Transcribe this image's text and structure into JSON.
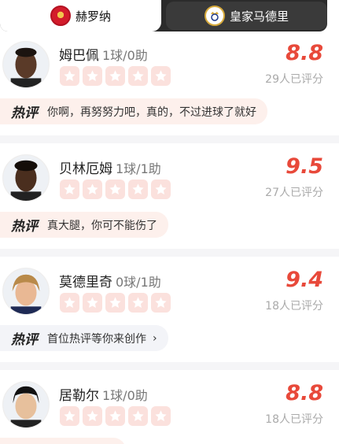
{
  "tabs": [
    {
      "label": "赫罗纳",
      "icon": "girona-crest-icon",
      "active": true
    },
    {
      "label": "皇家马德里",
      "icon": "real-madrid-crest-icon",
      "active": false
    }
  ],
  "players": [
    {
      "name": "姆巴佩",
      "stats": "1球/0助",
      "score": "8.8",
      "rated_count": "29人已评分",
      "stars_filled": 0,
      "hot_label": "热评",
      "hot_text": "你啊，再努努力吧，真的，不过进球了就好"
    },
    {
      "name": "贝林厄姆",
      "stats": "1球/1助",
      "score": "9.5",
      "rated_count": "27人已评分",
      "stars_filled": 0,
      "hot_label": "热评",
      "hot_text": "真大腿，你可不能伤了"
    },
    {
      "name": "莫德里奇",
      "stats": "0球/1助",
      "score": "9.4",
      "rated_count": "18人已评分",
      "stars_filled": 0,
      "hot_label": "热评",
      "hot_text": "首位热评等你来创作"
    },
    {
      "name": "居勒尔",
      "stats": "1球/0助",
      "score": "8.8",
      "rated_count": "18人已评分",
      "stars_filled": 0
    }
  ],
  "colors": {
    "accent": "#e8493a",
    "star_bg": "#fbe1dd",
    "hot_bg": "#fdf0ec",
    "dark_tab": "#2b2b2b"
  }
}
